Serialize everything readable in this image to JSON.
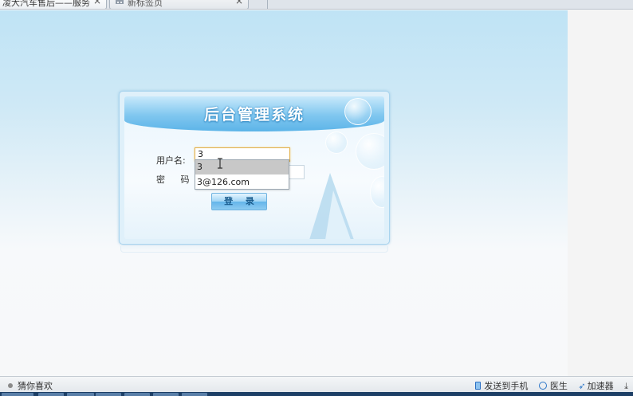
{
  "browser": {
    "tabs": [
      {
        "title": "凌大汽车售后——服务管理",
        "active": true
      },
      {
        "title": "新标签页",
        "active": false
      }
    ],
    "close_glyph": "×"
  },
  "login": {
    "title": "后台管理系统",
    "username_label": "用户名:",
    "password_label": "密 码:",
    "username_value": "3",
    "password_value": "",
    "login_button": "登 录",
    "autocomplete": [
      "3",
      "3@126.com"
    ]
  },
  "statusbar": {
    "left": "猜你喜欢",
    "send_to_phone": "发送到手机",
    "doctor": "医生",
    "accelerator": "加速器"
  },
  "icons": {
    "tab_close": "close-icon",
    "newtab": "grid-icon",
    "phone": "phone-icon",
    "doctor": "doctor-icon",
    "accelerator": "rocket-icon",
    "download": "download-icon"
  },
  "colors": {
    "banner": "#5cb4e8",
    "button": "#63b5ea",
    "focus_border": "#e2b14d",
    "autocomplete_selected": "#c8c8c8"
  }
}
